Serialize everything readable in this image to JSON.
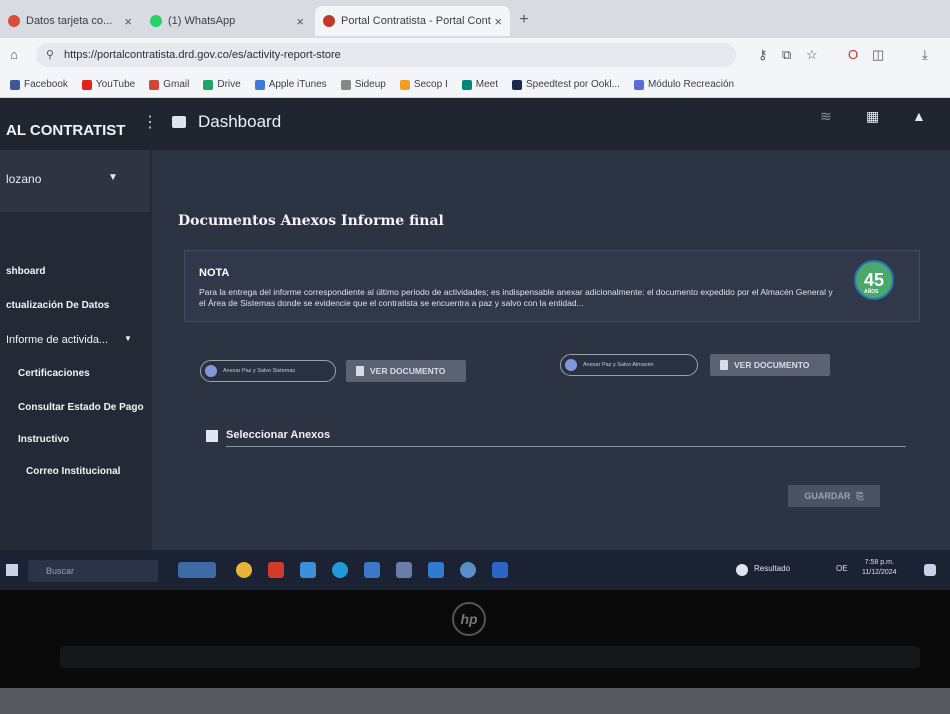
{
  "browser": {
    "tabs": [
      {
        "label": "Datos tarjeta co...",
        "close": "×",
        "color": "#d94e3a"
      },
      {
        "label": "(1) WhatsApp",
        "close": "×",
        "color": "#25d366"
      },
      {
        "label": "Portal Contratista - Portal Cont",
        "close": "×",
        "color": "#c0392b"
      }
    ],
    "new_tab": "+",
    "url": "https://portalcontratista.drd.gov.co/es/activity-report-store",
    "bookmarks": [
      {
        "label": "Facebook",
        "color": "#3b5998"
      },
      {
        "label": "YouTube",
        "color": "#e62117"
      },
      {
        "label": "Gmail",
        "color": "#d44638"
      },
      {
        "label": "Drive",
        "color": "#1fa463"
      },
      {
        "label": "Apple iTunes",
        "color": "#3a7bd5"
      },
      {
        "label": "Sideup",
        "color": "#888888"
      },
      {
        "label": "Secop I",
        "color": "#f0a020"
      },
      {
        "label": "Meet",
        "color": "#00897b"
      },
      {
        "label": "Speedtest por Ookl...",
        "color": "#1a2b4c"
      },
      {
        "label": "Módulo Recreación",
        "color": "#5b6bd6"
      }
    ]
  },
  "app": {
    "brand": "AL CONTRATIST",
    "header_title": "Dashboard",
    "sidebar": {
      "user": "lozano",
      "items": [
        {
          "label": "shboard",
          "sub": false
        },
        {
          "label": "ctualización De Datos",
          "sub": false
        },
        {
          "label": "Informe de activida...",
          "sub": false
        },
        {
          "label": "Certificaciones",
          "sub": true
        },
        {
          "label": "Consultar Estado De Pago",
          "sub": true
        },
        {
          "label": "Instructivo",
          "sub": true
        },
        {
          "label": "Correo Institucional",
          "sub": true
        }
      ]
    },
    "card_title": "Documentos Anexos Informe final",
    "nota": {
      "heading": "NOTA",
      "text": "Para la entrega del informe correspondiente al último periodo de actividades; es indispensable anexar adicionalmente: el documento expedido por el Almacén General y el Área de Sistemas donde se evidencie que el contratista se encuentra a paz y salvo con la entidad..."
    },
    "badge": {
      "number": "45",
      "sub": "AÑOS"
    },
    "upload": [
      {
        "pill": "Anexar Paz y Salvo Sistemas",
        "button": "VER DOCUMENTO"
      },
      {
        "pill": "Anexar Paz y Salvo Almacén",
        "button": "VER DOCUMENTO"
      }
    ],
    "anexos_label": "Seleccionar Anexos",
    "save_button": "GUARDAR"
  },
  "taskbar": {
    "search_placeholder": "Buscar",
    "tray_status": "Resultado",
    "tray_lang": "OE",
    "time": "7:58 p.m.",
    "date": "11/12/2024"
  },
  "bezel": {
    "logo": "hp"
  }
}
